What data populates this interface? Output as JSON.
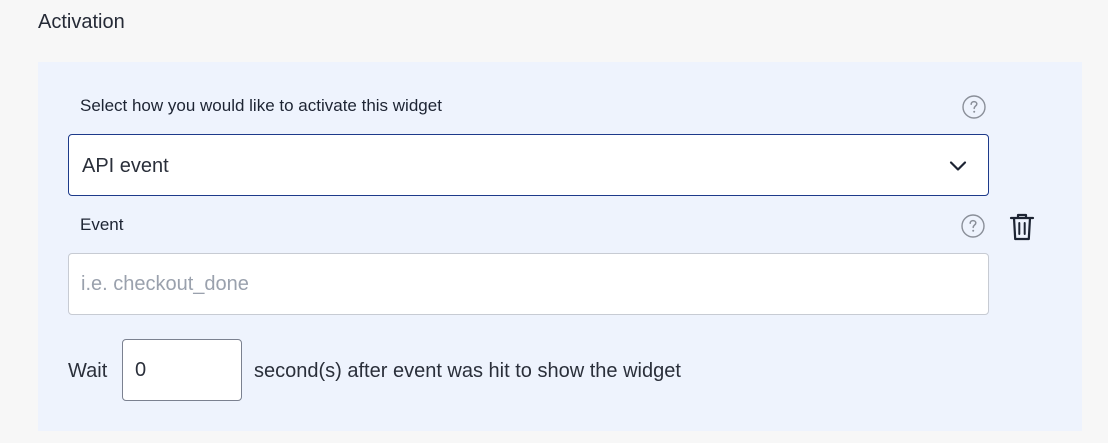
{
  "section": {
    "title": "Activation"
  },
  "activation": {
    "select_label": "Select how you would like to activate this widget",
    "select_value": "API event",
    "event_label": "Event",
    "event_value": "",
    "event_placeholder": "i.e. checkout_done",
    "wait_prefix": "Wait",
    "wait_value": "0",
    "wait_suffix": "second(s) after event was hit to show the widget"
  },
  "icons": {
    "help": "help-circle-icon",
    "dropdown": "chevron-down-icon",
    "delete": "trash-icon"
  },
  "colors": {
    "panel_bg": "#eef3fd",
    "page_bg": "#f7f7f7",
    "select_border": "#1d3a8a",
    "input_border": "#c7cbd3",
    "icon_gray": "#8a8f99",
    "text": "#1d2433"
  }
}
